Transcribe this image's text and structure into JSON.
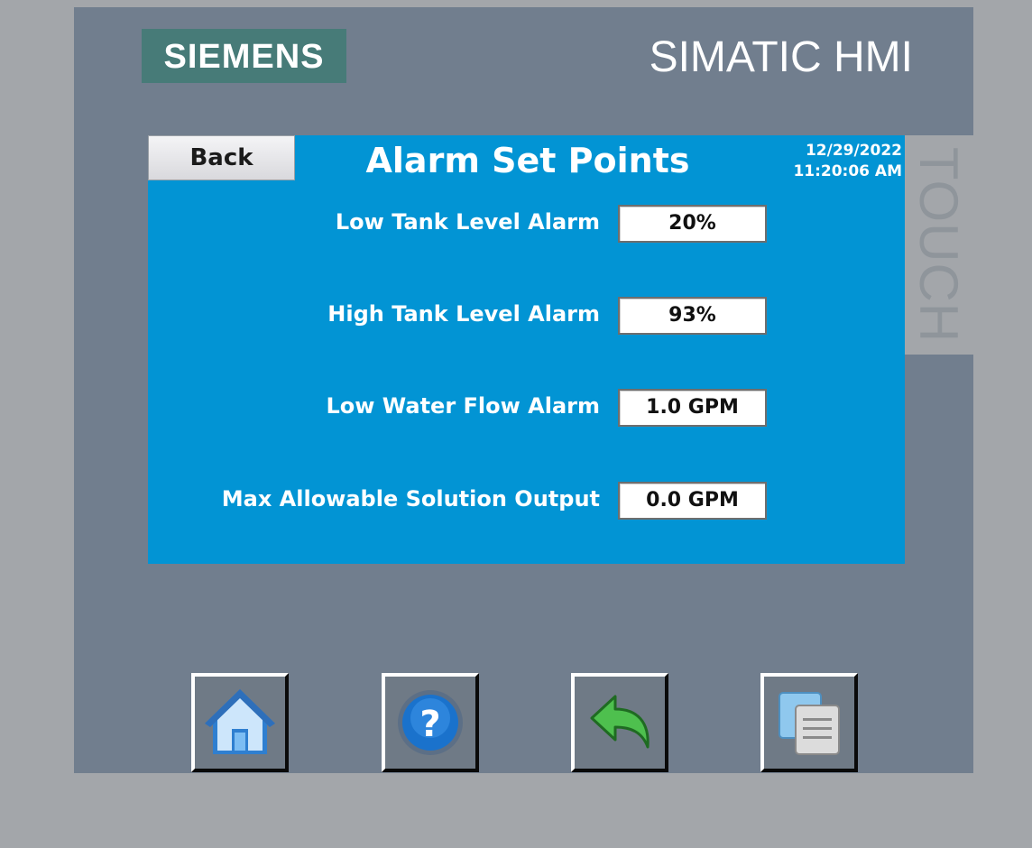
{
  "brand": {
    "logo_text": "SIEMENS",
    "product_text": "SIMATIC HMI",
    "touch_text": "TOUCH"
  },
  "screen": {
    "back_label": "Back",
    "title": "Alarm Set Points",
    "date": "12/29/2022",
    "time": "11:20:06 AM",
    "setpoints": [
      {
        "label": "Low Tank Level Alarm",
        "value": "20%"
      },
      {
        "label": "High Tank Level Alarm",
        "value": "93%"
      },
      {
        "label": "Low Water Flow Alarm",
        "value": "1.0 GPM"
      },
      {
        "label": "Max Allowable Solution Output",
        "value": "0.0 GPM"
      }
    ]
  },
  "nav": [
    {
      "icon": "home-icon"
    },
    {
      "icon": "help-icon"
    },
    {
      "icon": "return-arrow-icon"
    },
    {
      "icon": "screens-icon"
    }
  ],
  "colors": {
    "screen_background": "#0294d4",
    "bezel": "#717e8e",
    "brand_panel": "#477b78",
    "outer_frame": "#a3a6aa"
  }
}
